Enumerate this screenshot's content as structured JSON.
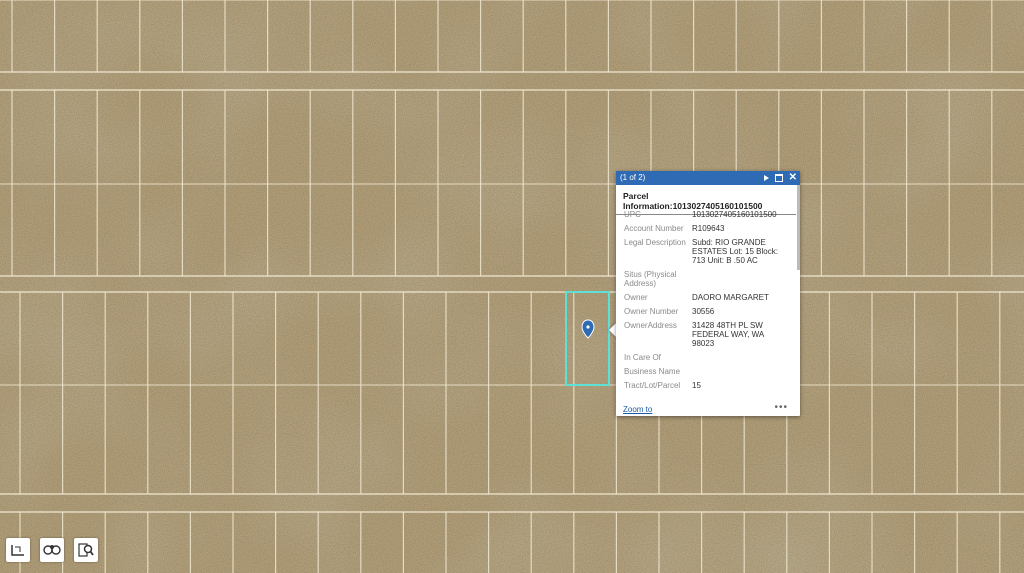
{
  "popup": {
    "counter": "(1 of 2)",
    "title": "Parcel Information:1013027405160101500",
    "fields": [
      {
        "key": "UPC",
        "value": "1013027405160101500"
      },
      {
        "key": "Account Number",
        "value": "R109643"
      },
      {
        "key": "Legal Description",
        "value": "Subd: RIO GRANDE ESTATES Lot: 15 Block: 713 Unit: B .50 AC"
      },
      {
        "key": "Situs (Physical Address)",
        "value": ""
      },
      {
        "key": "Owner",
        "value": "DAORO MARGARET"
      },
      {
        "key": "Owner Number",
        "value": "30556"
      },
      {
        "key": "OwnerAddress",
        "value": "31428 48TH PL SW FEDERAL WAY, WA 98023"
      },
      {
        "key": "In Care Of",
        "value": ""
      },
      {
        "key": "Business Name",
        "value": ""
      },
      {
        "key": "Tract/Lot/Parcel",
        "value": "15"
      }
    ],
    "zoom_label": "Zoom to",
    "more_label": "•••"
  },
  "colors": {
    "header": "#2f6bb5",
    "parcel_outline": "#5fe0d6",
    "marker": "#2f6bb5",
    "terrain": "#b09a72"
  },
  "tools": [
    {
      "name": "measure-tool-icon"
    },
    {
      "name": "layers-tool-icon"
    },
    {
      "name": "identify-tool-icon"
    }
  ]
}
